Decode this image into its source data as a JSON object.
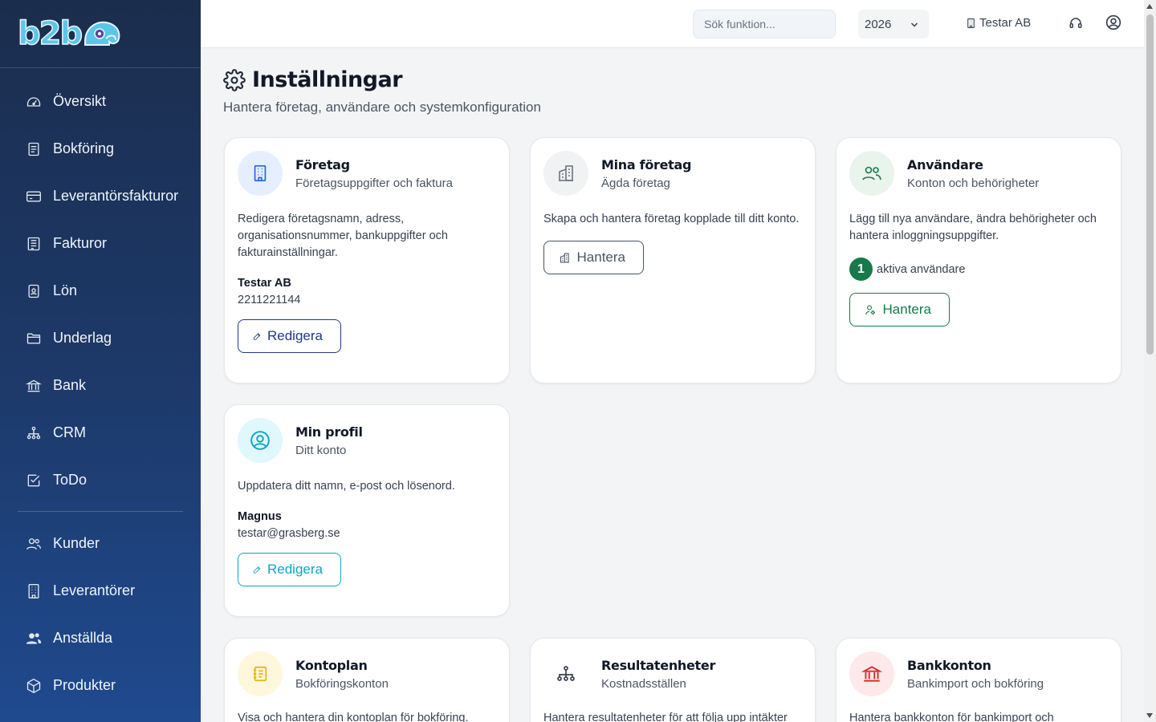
{
  "brand": {
    "logo_text": "b2b"
  },
  "sidebar": {
    "items": [
      {
        "label": "Översikt",
        "icon": "gauge-icon"
      },
      {
        "label": "Bokföring",
        "icon": "ledger-icon"
      },
      {
        "label": "Leverantörsfakturor",
        "icon": "credit-card-icon"
      },
      {
        "label": "Fakturor",
        "icon": "invoice-icon"
      },
      {
        "label": "Lön",
        "icon": "badge-icon"
      },
      {
        "label": "Underlag",
        "icon": "folder-icon"
      },
      {
        "label": "Bank",
        "icon": "bank-icon"
      },
      {
        "label": "CRM",
        "icon": "org-chart-icon"
      },
      {
        "label": "ToDo",
        "icon": "checkbox-icon"
      }
    ],
    "items2": [
      {
        "label": "Kunder",
        "icon": "users-icon"
      },
      {
        "label": "Leverantörer",
        "icon": "building-icon"
      },
      {
        "label": "Anställda",
        "icon": "people-icon"
      },
      {
        "label": "Produkter",
        "icon": "box-icon"
      }
    ]
  },
  "topbar": {
    "search_placeholder": "Sök funktion...",
    "year": "2026",
    "company": "Testar AB"
  },
  "page": {
    "title": "Inställningar",
    "subtitle": "Hantera företag, användare och systemkonfiguration"
  },
  "cards": {
    "foretag": {
      "title": "Företag",
      "subtitle": "Företagsuppgifter och faktura",
      "desc": "Redigera företagsnamn, adress, organisationsnummer, bankuppgifter och fakturainställningar.",
      "name": "Testar AB",
      "value": "2211221144",
      "button": "Redigera"
    },
    "mina_foretag": {
      "title": "Mina företag",
      "subtitle": "Ägda företag",
      "desc": "Skapa och hantera företag kopplade till ditt konto.",
      "button": "Hantera"
    },
    "anvandare": {
      "title": "Användare",
      "subtitle": "Konton och behörigheter",
      "desc": "Lägg till nya användare, ändra behörigheter och hantera inloggningsuppgifter.",
      "count": "1",
      "count_label": "aktiva användare",
      "button": "Hantera"
    },
    "min_profil": {
      "title": "Min profil",
      "subtitle": "Ditt konto",
      "desc": "Uppdatera ditt namn, e-post och lösenord.",
      "name": "Magnus",
      "value": "testar@grasberg.se",
      "button": "Redigera"
    },
    "kontoplan": {
      "title": "Kontoplan",
      "subtitle": "Bokföringskonton",
      "desc": "Visa och hantera din kontoplan för bokföring."
    },
    "resultatenheter": {
      "title": "Resultatenheter",
      "subtitle": "Kostnadsställen",
      "desc": "Hantera resultatenheter för att följa upp intäkter"
    },
    "bankkonton": {
      "title": "Bankkonton",
      "subtitle": "Bankimport och bokföring",
      "desc": "Hantera bankkonton för bankimport och"
    }
  },
  "colors": {
    "sidebar": "#1d3a6b",
    "primary_blue": "#1e3a8a",
    "green": "#177a4a",
    "cyan": "#0ea5c6"
  }
}
